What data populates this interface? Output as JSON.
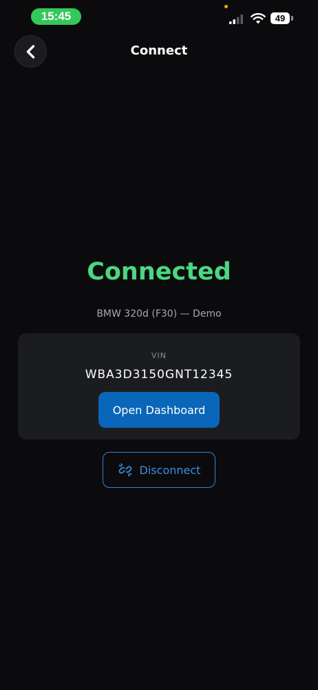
{
  "status_bar": {
    "time": "15:45",
    "battery": "49"
  },
  "header": {
    "title": "Connect",
    "back_icon": "chevron-left-icon"
  },
  "connection": {
    "status": "Connected",
    "vehicle": "BMW 320d (F30) — Demo",
    "status_color": "#4cd681"
  },
  "vin_card": {
    "label": "VIN",
    "value": "WBA3D3150GNT12345",
    "open_dashboard_label": "Open Dashboard"
  },
  "disconnect": {
    "label": "Disconnect",
    "icon": "unlink-icon"
  },
  "colors": {
    "background": "#0b0b0d",
    "card": "#1b1c20",
    "primary": "#0a66b8",
    "accent_blue": "#3a8ee0",
    "success_green": "#4cd681"
  }
}
